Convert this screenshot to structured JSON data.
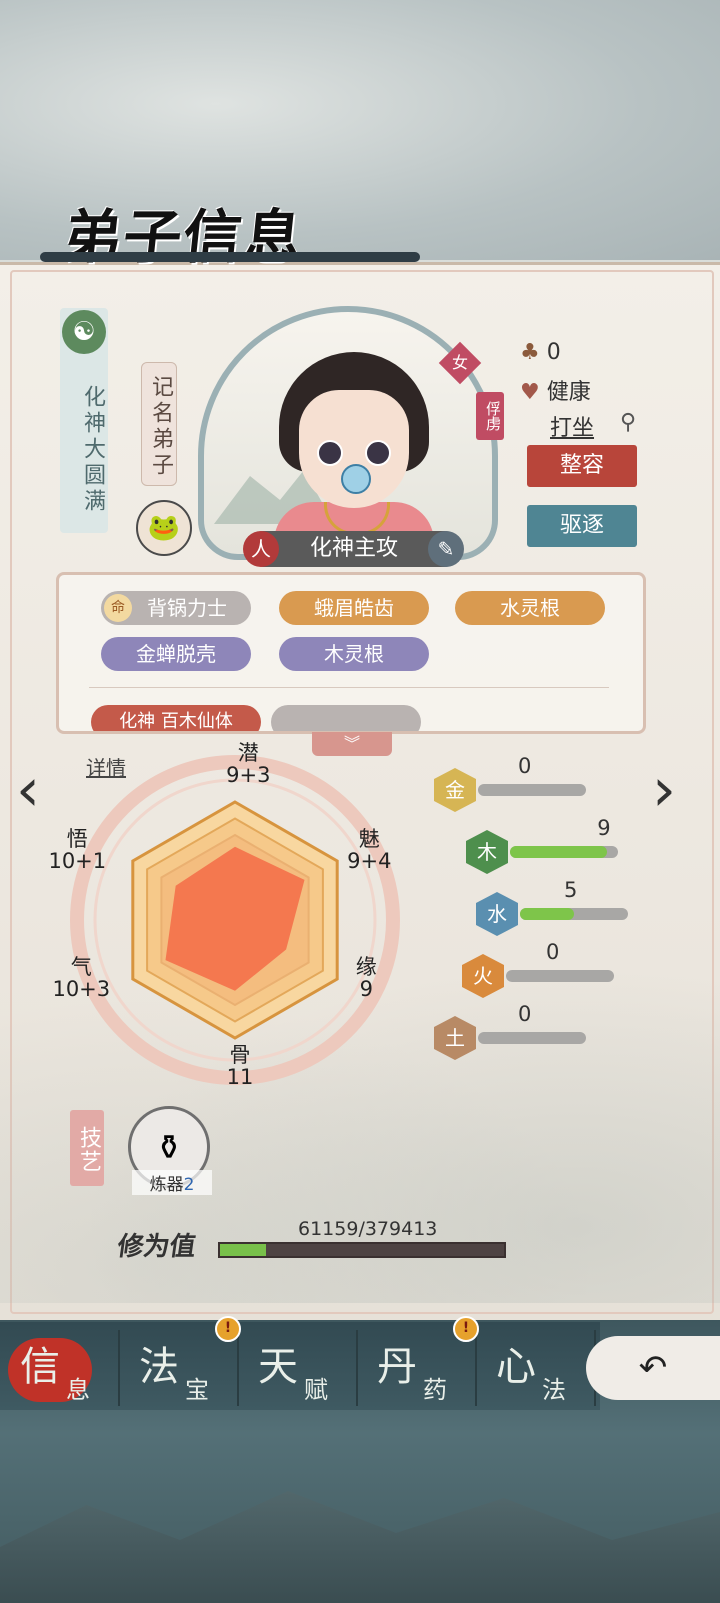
{
  "title": "弟子信息",
  "rank": "化神大圆满",
  "role": "记名弟子",
  "gender": "女",
  "status_tag": "俘虏",
  "name": "化神主攻",
  "right_panel": {
    "stat_value": "0",
    "health": "健康",
    "activity": "打坐",
    "btn_face": "整容",
    "btn_expel": "驱逐"
  },
  "traits": {
    "row1": [
      {
        "label": "背锅力士",
        "icon": "命",
        "color": "gray"
      },
      {
        "label": "蛾眉皓齿",
        "color": "orange"
      },
      {
        "label": "水灵根",
        "color": "orange"
      }
    ],
    "row2": [
      {
        "label": "金蝉脱壳",
        "color": "purple"
      },
      {
        "label": "木灵根",
        "color": "purple"
      }
    ],
    "partial": "化神 百木仙体"
  },
  "detail_link": "详情",
  "radar": {
    "stats": [
      {
        "name": "潜",
        "value": "9+3",
        "level": 0.62
      },
      {
        "name": "魅",
        "value": "9+4",
        "level": 0.68
      },
      {
        "name": "缘",
        "value": "9",
        "level": 0.5
      },
      {
        "name": "骨",
        "value": "11",
        "level": 0.6
      },
      {
        "name": "气",
        "value": "10+3",
        "level": 0.68
      },
      {
        "name": "悟",
        "value": "10+1",
        "level": 0.58
      }
    ]
  },
  "elements": [
    {
      "name": "金",
      "value": "0",
      "fill": 0,
      "color": "#d6b554"
    },
    {
      "name": "木",
      "value": "9",
      "fill": 0.9,
      "color": "#4e8f4d"
    },
    {
      "name": "水",
      "value": "5",
      "fill": 0.5,
      "color": "#5a8fb0"
    },
    {
      "name": "火",
      "value": "0",
      "fill": 0,
      "color": "#d98a3c"
    },
    {
      "name": "土",
      "value": "0",
      "fill": 0,
      "color": "#b88a65"
    }
  ],
  "skills": {
    "tag": "技艺",
    "item_label": "炼器",
    "item_level": "2"
  },
  "cultivation": {
    "label": "修为值",
    "value": "61159/379413",
    "progress": 0.161
  },
  "tabs": [
    {
      "big": "信",
      "small": "息",
      "active": true
    },
    {
      "big": "法",
      "small": "宝",
      "badge": true
    },
    {
      "big": "天",
      "small": "赋"
    },
    {
      "big": "丹",
      "small": "药",
      "badge": true
    },
    {
      "big": "心",
      "small": "法"
    }
  ],
  "colors": {
    "accent_red": "#c03228",
    "btn_red": "#b8453a",
    "btn_teal": "#4f8593",
    "progress_green": "#78c04a"
  }
}
